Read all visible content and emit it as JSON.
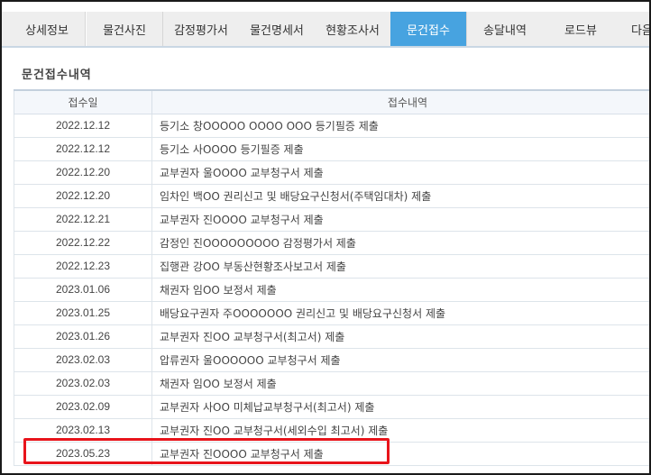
{
  "tabs": [
    {
      "label": "상세정보",
      "active": false
    },
    {
      "label": "물건사진",
      "active": false
    },
    {
      "label": "감정평가서",
      "active": false
    },
    {
      "label": "물건명세서",
      "active": false
    },
    {
      "label": "현황조사서",
      "active": false
    },
    {
      "label": "문건접수",
      "active": true
    },
    {
      "label": "송달내역",
      "active": false
    },
    {
      "label": "로드뷰",
      "active": false
    },
    {
      "label": "다음",
      "active": false
    }
  ],
  "section_title": "문건접수내역",
  "table": {
    "headers": [
      "접수일",
      "접수내역"
    ],
    "rows": [
      {
        "date": "2022.12.12",
        "content": "등기소 창OOOOO OOOO OOO 등기필증 제출"
      },
      {
        "date": "2022.12.12",
        "content": "등기소 사OOOO 등기필증 제출"
      },
      {
        "date": "2022.12.20",
        "content": "교부권자 울OOOO 교부청구서 제출"
      },
      {
        "date": "2022.12.20",
        "content": "임차인 백OO 권리신고 및 배당요구신청서(주택임대차) 제출"
      },
      {
        "date": "2022.12.21",
        "content": "교부권자 진OOOO 교부청구서 제출"
      },
      {
        "date": "2022.12.22",
        "content": "감정인 진OOOOOOOOO 감정평가서 제출"
      },
      {
        "date": "2022.12.23",
        "content": "집행관 강OO 부동산현황조사보고서 제출"
      },
      {
        "date": "2023.01.06",
        "content": "채권자 임OO 보정서 제출"
      },
      {
        "date": "2023.01.25",
        "content": "배당요구권자 주OOOOOOO 권리신고 및 배당요구신청서 제출"
      },
      {
        "date": "2023.01.26",
        "content": "교부권자 진OO 교부청구서(최고서) 제출"
      },
      {
        "date": "2023.02.03",
        "content": "압류권자 울OOOOOO 교부청구서 제출"
      },
      {
        "date": "2023.02.03",
        "content": "채권자 임OO 보정서 제출"
      },
      {
        "date": "2023.02.09",
        "content": "교부권자 사OO 미체납교부청구서(최고서) 제출"
      },
      {
        "date": "2023.02.13",
        "content": "교부권자 진OO 교부청구서(세외수입 최고서) 제출"
      },
      {
        "date": "2023.05.23",
        "content": "교부권자 진OOOO 교부청구서 제출"
      }
    ]
  },
  "colors": {
    "active_tab": "#47a3e0",
    "inactive_tab": "#eeeeee",
    "highlight": "#e8141b"
  }
}
